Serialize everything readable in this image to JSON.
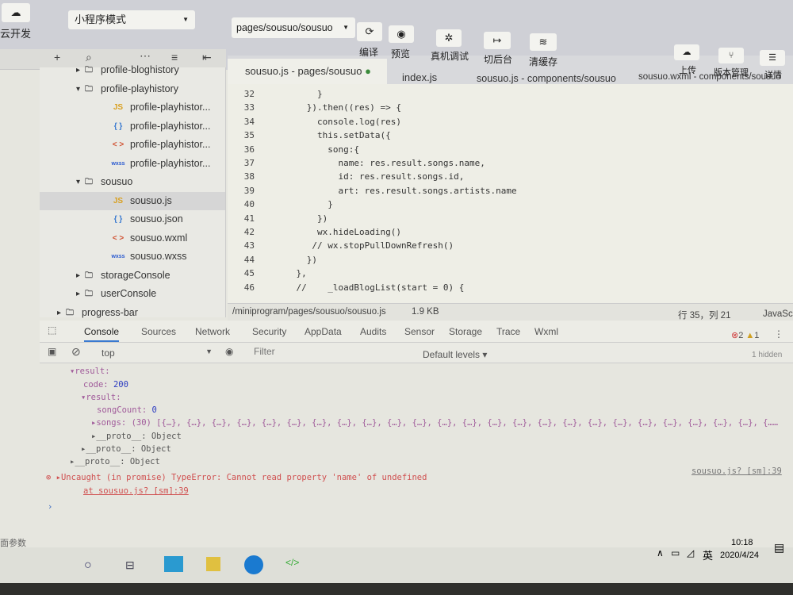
{
  "toolbar": {
    "cloud_label": "云开发",
    "mode_select": "小程序模式",
    "page_select": "pages/sousuo/sousuo",
    "compile": "编译",
    "preview": "预览",
    "remote_debug": "真机调试",
    "background": "切后台",
    "clear_cache": "清缓存",
    "upload": "上传",
    "version": "版本管理",
    "details": "详情"
  },
  "sidebar": {
    "items": [
      {
        "label": "profile-bloghistory",
        "type": "folder",
        "indent": 1
      },
      {
        "label": "profile-playhistory",
        "type": "folder",
        "indent": 1,
        "open": true
      },
      {
        "label": "profile-playhistor...",
        "type": "js",
        "indent": 2
      },
      {
        "label": "profile-playhistor...",
        "type": "json",
        "indent": 2
      },
      {
        "label": "profile-playhistor...",
        "type": "wxml",
        "indent": 2
      },
      {
        "label": "profile-playhistor...",
        "type": "wxss",
        "indent": 2
      },
      {
        "label": "sousuo",
        "type": "folder",
        "indent": 1,
        "open": true
      },
      {
        "label": "sousuo.js",
        "type": "js",
        "indent": 2,
        "selected": true
      },
      {
        "label": "sousuo.json",
        "type": "json",
        "indent": 2
      },
      {
        "label": "sousuo.wxml",
        "type": "wxml",
        "indent": 2
      },
      {
        "label": "sousuo.wxss",
        "type": "wxss",
        "indent": 2
      },
      {
        "label": "storageConsole",
        "type": "folder",
        "indent": 1
      },
      {
        "label": "userConsole",
        "type": "folder",
        "indent": 1
      },
      {
        "label": "progress-bar",
        "type": "folder",
        "indent": 0
      }
    ]
  },
  "tabs": [
    {
      "label": "sousuo.js - pages/sousuo",
      "active": true
    },
    {
      "label": "index.js"
    },
    {
      "label": "sousuo.js - components/sousuo"
    },
    {
      "label": "sousuo.wxml - components/sousuo"
    }
  ],
  "editor": {
    "lines": [
      {
        "n": "32",
        "code": "        }"
      },
      {
        "n": "33",
        "code": "      }).then((res) => {"
      },
      {
        "n": "34",
        "code": "        console.log(res)"
      },
      {
        "n": "35",
        "code": "        this.setData({"
      },
      {
        "n": "36",
        "code": "          song:{"
      },
      {
        "n": "37",
        "code": "            name: res.result.songs.name,"
      },
      {
        "n": "38",
        "code": "            id: res.result.songs.id,"
      },
      {
        "n": "39",
        "code": "            art: res.result.songs.artists.name"
      },
      {
        "n": "40",
        "code": "          }"
      },
      {
        "n": "41",
        "code": "        })"
      },
      {
        "n": "42",
        "code": "        wx.hideLoading()"
      },
      {
        "n": "43",
        "code": "       // wx.stopPullDownRefresh()"
      },
      {
        "n": "44",
        "code": "      })"
      },
      {
        "n": "45",
        "code": "    },"
      },
      {
        "n": "46",
        "code": "    //    _loadBlogList(start = 0) {"
      }
    ]
  },
  "status": {
    "path": "/miniprogram/pages/sousuo/sousuo.js",
    "size": "1.9 KB",
    "cursor": "行 35，列 21",
    "lang": "JavaScript"
  },
  "devtools": {
    "tabs": [
      "Console",
      "Sources",
      "Network",
      "Security",
      "AppData",
      "Audits",
      "Sensor",
      "Storage",
      "Trace",
      "Wxml"
    ],
    "errors": "2",
    "warnings": "1",
    "context": "top",
    "filter_placeholder": "Filter",
    "levels": "Default levels ▾",
    "hidden": "1 hidden"
  },
  "console": {
    "l1": "▾result:",
    "l2k": "code: ",
    "l2v": "200",
    "l3": "▾result:",
    "l4k": "songCount: ",
    "l4v": "0",
    "l5": "▸songs: (30) [{…}, {…}, {…}, {…}, {…}, {…}, {…}, {…}, {…}, {…}, {…}, {…}, {…}, {…}, {…}, {…}, {…}, {…}, {…}, {…}, {…}, {…}, {…}, {…}, {……",
    "l6": "▸__proto__: Object",
    "l7": "▸__proto__: Object",
    "l8": "▸__proto__: Object",
    "error": "▸Uncaught (in promise) TypeError: Cannot read property 'name' of undefined",
    "error_at": "at sousuo.js? [sm]:39",
    "error_src": "sousuo.js? [sm]:39",
    "prompt": "›"
  },
  "bottom_label": "面参数",
  "taskbar": {
    "ime": "英",
    "time": "10:18",
    "date": "2020/4/24"
  }
}
